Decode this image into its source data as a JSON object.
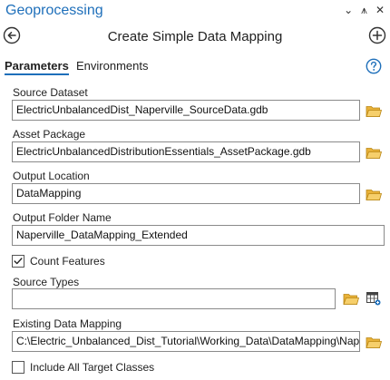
{
  "pane": {
    "title": "Geoprocessing",
    "dropdown_glyph": "⌄",
    "pin_glyph": "⩚",
    "close_glyph": "✕"
  },
  "tool": {
    "title": "Create Simple Data Mapping"
  },
  "tabs": {
    "parameters": "Parameters",
    "environments": "Environments"
  },
  "params": {
    "source_dataset": {
      "label": "Source Dataset",
      "value": "ElectricUnbalancedDist_Naperville_SourceData.gdb"
    },
    "asset_package": {
      "label": "Asset Package",
      "value": "ElectricUnbalancedDistributionEssentials_AssetPackage.gdb"
    },
    "output_location": {
      "label": "Output Location",
      "value": "DataMapping"
    },
    "output_folder_name": {
      "label": "Output Folder Name",
      "value": "Naperville_DataMapping_Extended"
    },
    "count_features": {
      "label": "Count Features",
      "checked": true
    },
    "source_types": {
      "label": "Source Types",
      "value": ""
    },
    "existing_data_mapping": {
      "label": "Existing Data Mapping",
      "value": "C:\\Electric_Unbalanced_Dist_Tutorial\\Working_Data\\DataMapping\\Nap"
    },
    "include_all_target_classes": {
      "label": "Include All Target Classes",
      "checked": false
    }
  },
  "colors": {
    "accent": "#1e6fba",
    "folder": "#e8b23a",
    "border": "#8a8a8a"
  },
  "icons": [
    "back-icon",
    "add-icon",
    "help-icon",
    "folder-icon",
    "table-options-icon",
    "checkmark-icon"
  ]
}
